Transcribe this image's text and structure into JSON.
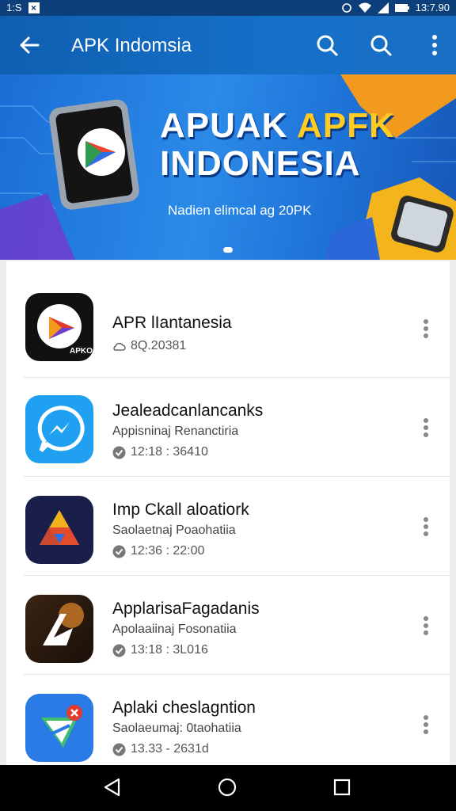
{
  "status_bar": {
    "left_text": "1:S",
    "time": "13:7.90",
    "icons": [
      "close-box-icon",
      "alarm-icon",
      "wifi-icon",
      "signal-icon",
      "battery-icon"
    ]
  },
  "app_bar": {
    "title": "APK Indomsia",
    "icons": [
      "back-arrow-icon",
      "search-icon",
      "search-icon",
      "more-vert-icon"
    ],
    "color": "#1570c8"
  },
  "banner": {
    "title_white": "APUAK ",
    "title_accent": "APFK",
    "title_line2": "INDONESIA",
    "subtitle": "Nadien elimcal ag 20PK",
    "accent_color": "#ffcc1f",
    "pages_indicator": "1"
  },
  "apps": [
    {
      "name": "APR lIantanesia",
      "developer": "",
      "meta": "8Q.20381",
      "meta_icon": "cloud-icon",
      "icon_colors": [
        "#111111",
        "#ffffff"
      ]
    },
    {
      "name": "Jealeadcanlancanks",
      "developer": "Appisninaj Renanctiria",
      "meta": "12:18 : 36410",
      "meta_icon": "check-circle-icon",
      "icon_colors": [
        "#1fa0f0",
        "#ffffff"
      ]
    },
    {
      "name": "Imp Ckall aloatiork",
      "developer": "Saolaetnaj Poaohatiia",
      "meta": "12:36 : 22:00",
      "meta_icon": "check-circle-icon",
      "icon_colors": [
        "#1a1f4a",
        "#f2b21c"
      ]
    },
    {
      "name": "ApplarisaFagadanis",
      "developer": "Apolaaiinaj Fosonatiia",
      "meta": "13:18 : 3L016",
      "meta_icon": "check-circle-icon",
      "icon_colors": [
        "#2a1a10",
        "#e48a2a"
      ]
    },
    {
      "name": "Aplaki cheslagntion",
      "developer": "Saolaeumaj: 0taohatiia",
      "meta": "13.33 - 2631d",
      "meta_icon": "check-circle-icon",
      "icon_colors": [
        "#2a7be6",
        "#3fbf6a"
      ]
    }
  ],
  "nav_bar": {
    "icons": [
      "back-triangle-icon",
      "home-circle-icon",
      "recents-square-icon"
    ]
  }
}
